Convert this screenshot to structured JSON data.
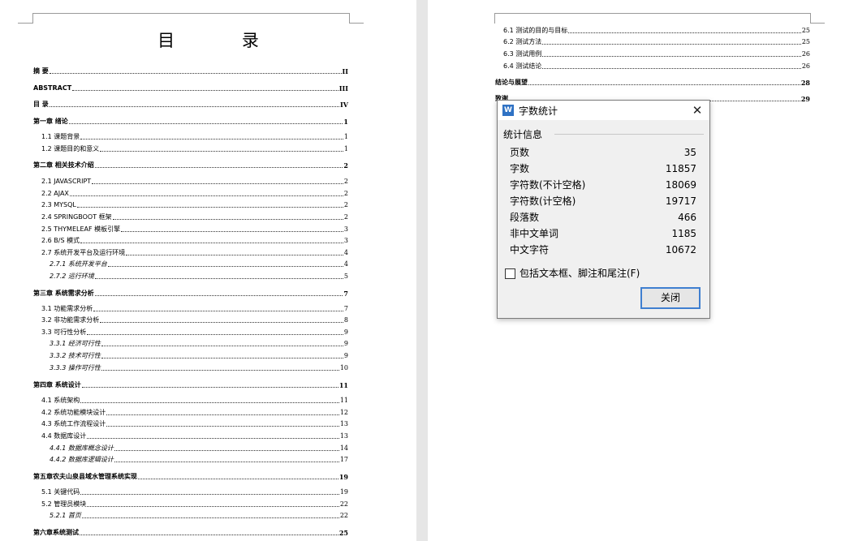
{
  "left_page": {
    "title": "目   录",
    "entries": [
      {
        "label": "摘    要",
        "page": "II",
        "level": "h"
      },
      {
        "label": "ABSTRACT",
        "page": "III",
        "level": "h"
      },
      {
        "label": "目    录",
        "page": "IV",
        "level": "h"
      },
      {
        "label": "第一章  绪论",
        "page": "1",
        "level": "h"
      },
      {
        "label": "1.1  课题背景",
        "page": "1",
        "level": "s"
      },
      {
        "label": "1.2  课题目的和意义",
        "page": "1",
        "level": "s"
      },
      {
        "label": "第二章  相关技术介绍",
        "page": "2",
        "level": "h"
      },
      {
        "label": "2.1 JAVASCRIPT",
        "page": "2",
        "level": "s"
      },
      {
        "label": "2.2 AJAX",
        "page": "2",
        "level": "s"
      },
      {
        "label": "2.3 MYSQL",
        "page": "2",
        "level": "s"
      },
      {
        "label": "2.4 SPRINGBOOT 框架",
        "page": "2",
        "level": "s"
      },
      {
        "label": "2.5 THYMELEAF 模板引擎",
        "page": "3",
        "level": "s"
      },
      {
        "label": "2.6 B/S 模式",
        "page": "3",
        "level": "s"
      },
      {
        "label": "2.7  系统开发平台及运行环境",
        "page": "4",
        "level": "s"
      },
      {
        "label": "2.7.1  系统开发平台",
        "page": "4",
        "level": "ss"
      },
      {
        "label": "2.7.2  运行环境",
        "page": "5",
        "level": "ss"
      },
      {
        "label": "第三章  系统需求分析",
        "page": "7",
        "level": "h"
      },
      {
        "label": "3.1  功能需求分析",
        "page": "7",
        "level": "s"
      },
      {
        "label": "3.2  非功能需求分析",
        "page": "8",
        "level": "s"
      },
      {
        "label": "3.3  可行性分析",
        "page": "9",
        "level": "s"
      },
      {
        "label": "3.3.1  经济可行性",
        "page": "9",
        "level": "ss"
      },
      {
        "label": "3.3.2  技术可行性",
        "page": "9",
        "level": "ss"
      },
      {
        "label": "3.3.3  操作可行性",
        "page": "10",
        "level": "ss"
      },
      {
        "label": "第四章  系统设计",
        "page": "11",
        "level": "h"
      },
      {
        "label": "4.1  系统架构",
        "page": "11",
        "level": "s"
      },
      {
        "label": "4.2  系统功能模块设计",
        "page": "12",
        "level": "s"
      },
      {
        "label": "4.3  系统工作流程设计",
        "page": "13",
        "level": "s"
      },
      {
        "label": "4.4  数据库设计",
        "page": "13",
        "level": "s"
      },
      {
        "label": "4.4.1  数据库概念设计",
        "page": "14",
        "level": "ss"
      },
      {
        "label": "4.4.2  数据库逻辑设计",
        "page": "17",
        "level": "ss"
      },
      {
        "label": "第五章农夫山泉县域水管理系统实现",
        "page": "19",
        "level": "h"
      },
      {
        "label": "5.1  关键代码",
        "page": "19",
        "level": "s"
      },
      {
        "label": "5.2  管理员模块",
        "page": "22",
        "level": "s"
      },
      {
        "label": "5.2.1  首页",
        "page": "22",
        "level": "ss"
      },
      {
        "label": "第六章系统测试",
        "page": "25",
        "level": "h"
      }
    ]
  },
  "right_page": {
    "entries": [
      {
        "label": "6.1  测试的目的与目标",
        "page": "25",
        "level": "s"
      },
      {
        "label": "6.2  测试方法",
        "page": "25",
        "level": "s"
      },
      {
        "label": "6.3  测试用例",
        "page": "26",
        "level": "s"
      },
      {
        "label": "6.4  测试结论",
        "page": "26",
        "level": "s"
      },
      {
        "label": "结论与展望",
        "page": "28",
        "level": "h"
      },
      {
        "label": "致谢",
        "page": "29",
        "level": "h"
      }
    ]
  },
  "dialog": {
    "app_icon": "W",
    "title": "字数统计",
    "close_glyph": "✕",
    "group_label": "统计信息",
    "stats": [
      {
        "label": "页数",
        "value": "35"
      },
      {
        "label": "字数",
        "value": "11857"
      },
      {
        "label": "字符数(不计空格)",
        "value": "18069"
      },
      {
        "label": "字符数(计空格)",
        "value": "19717"
      },
      {
        "label": "段落数",
        "value": "466"
      },
      {
        "label": "非中文单词",
        "value": "1185"
      },
      {
        "label": "中文字符",
        "value": "10672"
      }
    ],
    "checkbox_label": "包括文本框、脚注和尾注(F)",
    "checkbox_checked": false,
    "close_button_label": "关闭"
  }
}
